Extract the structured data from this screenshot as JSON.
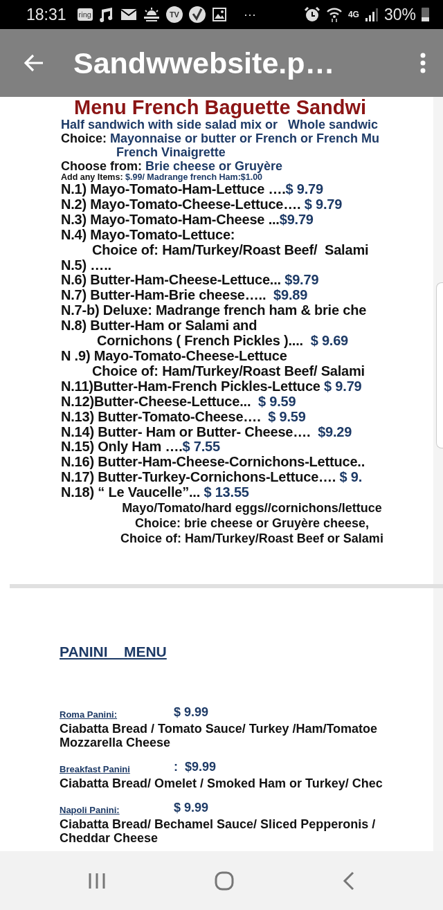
{
  "status_bar": {
    "time": "18:31",
    "notifications": [
      {
        "kind": "ring",
        "label": "ring"
      },
      {
        "kind": "music"
      },
      {
        "kind": "mail"
      },
      {
        "kind": "weather"
      },
      {
        "kind": "tv",
        "label": "TV"
      },
      {
        "kind": "check"
      },
      {
        "kind": "image"
      },
      {
        "kind": "more",
        "label": "···"
      }
    ],
    "network": "4G",
    "battery": "30%"
  },
  "app_bar": {
    "title": "Sandwwebsite.p…"
  },
  "menu": {
    "title": "Menu French Baguette Sandwi",
    "lines": [
      {
        "kind": "intro",
        "accent": "Half sandwich with side salad mix or   Whole sandwic"
      },
      {
        "kind": "intro",
        "text": "Choice: ",
        "accent": "Mayonnaise or butter or French or French Mu"
      },
      {
        "kind": "intro-cont",
        "accent": "French Vinaigrette"
      },
      {
        "kind": "intro",
        "text": "Choose from: ",
        "accent": "Brie cheese or Gruyère"
      },
      {
        "kind": "small",
        "text": "Add any Items: ",
        "accent": "$.99/ Madrange french Ham:$1.00"
      },
      {
        "kind": "item",
        "text": "N.1) Mayo-Tomato-Ham-Lettuce ….",
        "accent": "$ 9.79"
      },
      {
        "kind": "item",
        "text": "N.2) Mayo-Tomato-Cheese-Lettuce…. ",
        "accent": "$ 9.79"
      },
      {
        "kind": "item",
        "text": "N.3) Mayo-Tomato-Ham-Cheese ...",
        "accent": "$9.79"
      },
      {
        "kind": "item",
        "text": "N.4) Mayo-Tomato-Lettuce:"
      },
      {
        "kind": "item-cont",
        "text": "Choice of: Ham/Turkey/Roast Beef/  Salami"
      },
      {
        "kind": "item",
        "text": "N.5) ….."
      },
      {
        "kind": "item",
        "text": "N.6) Butter-Ham-Cheese-Lettuce... ",
        "accent": "$9.79"
      },
      {
        "kind": "item",
        "text": "N.7) Butter-Ham-Brie cheese…..  ",
        "accent": "$9.89"
      },
      {
        "kind": "item",
        "text": "N.7-b) Deluxe: Madrange french ham & brie che"
      },
      {
        "kind": "item",
        "text": "N.8) Butter-Ham or Salami and"
      },
      {
        "kind": "item-cont2",
        "text": "Cornichons ( French Pickles )....  ",
        "accent": "$ 9.69"
      },
      {
        "kind": "item",
        "text": "N .9) Mayo-Tomato-Cheese-Lettuce"
      },
      {
        "kind": "item-cont",
        "text": "Choice of: Ham/Turkey/Roast Beef/ Salami"
      },
      {
        "kind": "item",
        "text": "N.11)Butter-Ham-French Pickles-Lettuce ",
        "accent": "$ 9.79"
      },
      {
        "kind": "item",
        "text": "N.12)Butter-Cheese-Lettuce...  ",
        "accent": "$ 9.59"
      },
      {
        "kind": "item",
        "text": "N.13) Butter-Tomato-Cheese….  ",
        "accent": "$ 9.59"
      },
      {
        "kind": "item",
        "text": "N.14) Butter- Ham or Butter- Cheese….  ",
        "accent": "$9.29"
      },
      {
        "kind": "item",
        "text": "N.15) Only Ham ….",
        "accent": "$ 7.55"
      },
      {
        "kind": "item",
        "text": "N.16) Butter-Ham-Cheese-Cornichons-Lettuce.."
      },
      {
        "kind": "item",
        "text": "N.17) Butter-Turkey-Cornichons-Lettuce…. ",
        "accent": "$ 9."
      },
      {
        "kind": "item",
        "text": "N.18) “ Le Vaucelle”... ",
        "accent": "$ 13.55"
      },
      {
        "kind": "centered",
        "text": "Mayo/Tomato/hard eggs//cornichons/lettuce"
      },
      {
        "kind": "centered",
        "text": "Choice: brie cheese or Gruyère cheese,"
      },
      {
        "kind": "centered",
        "text": "Choice of: Ham/Turkey/Roast Beef or Salami"
      }
    ]
  },
  "panini": {
    "heading": "PANINI    MENU",
    "items": [
      {
        "name": "Roma Panini:",
        "price": "$ 9.99",
        "description": [
          "Ciabatta Bread / Tomato Sauce/ Turkey /Ham/Tomatoe",
          "Mozzarella Cheese"
        ]
      },
      {
        "name": "Breakfast Panini",
        "price": ":  $9.99",
        "description": [
          "Ciabatta Bread/ Omelet / Smoked Ham or Turkey/ Chec"
        ]
      },
      {
        "name": "Napoli Panini:",
        "price": "$ 9.99",
        "description": [
          "Ciabatta Bread/ Bechamel Sauce/ Sliced Pepperonis /",
          "Cheddar Cheese"
        ]
      }
    ]
  }
}
